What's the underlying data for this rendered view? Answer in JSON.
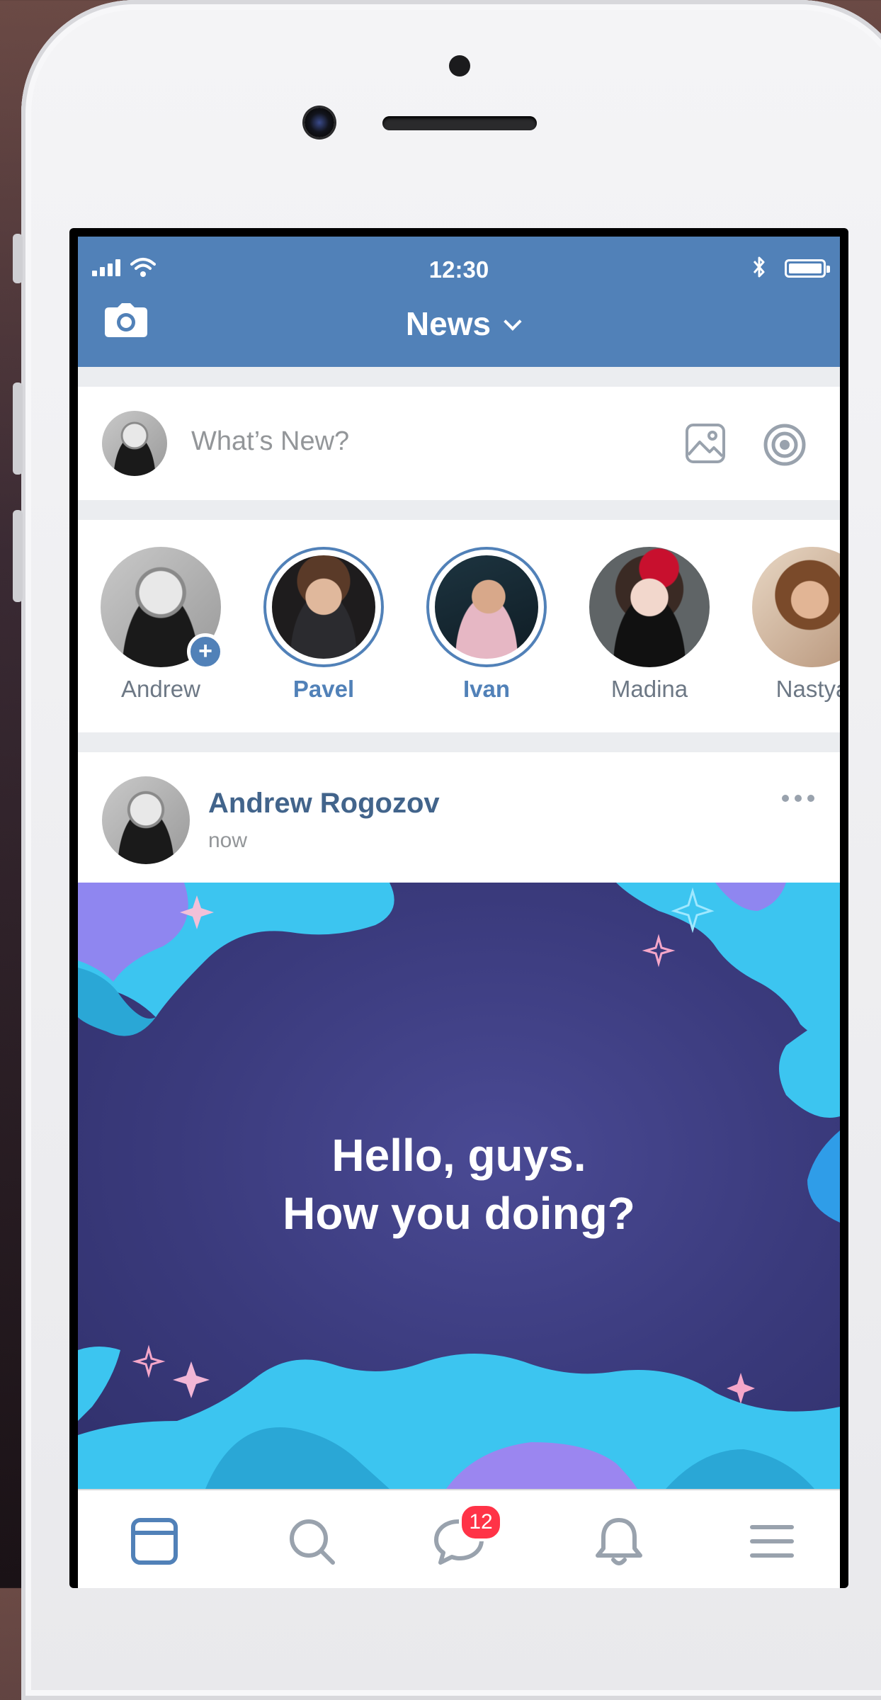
{
  "status_bar": {
    "time": "12:30"
  },
  "header": {
    "title": "News"
  },
  "composer": {
    "placeholder": "What’s New?"
  },
  "stories": [
    {
      "name": "Andrew",
      "active": false
    },
    {
      "name": "Pavel",
      "active": true
    },
    {
      "name": "Ivan",
      "active": true
    },
    {
      "name": "Madina",
      "active": false
    },
    {
      "name": "Nastya",
      "active": false
    }
  ],
  "post": {
    "author": "Andrew Rogozov",
    "time": "now",
    "text_line1": "Hello, guys.",
    "text_line2": "How you doing?"
  },
  "tabbar": {
    "items": [
      "news-icon",
      "search-icon",
      "messages-icon",
      "notifications-icon",
      "menu-icon"
    ],
    "messages_badge": "12"
  },
  "colors": {
    "accent": "#5181b8",
    "author": "#42648b",
    "badge": "#ff3347",
    "background": "#ebedf0"
  }
}
